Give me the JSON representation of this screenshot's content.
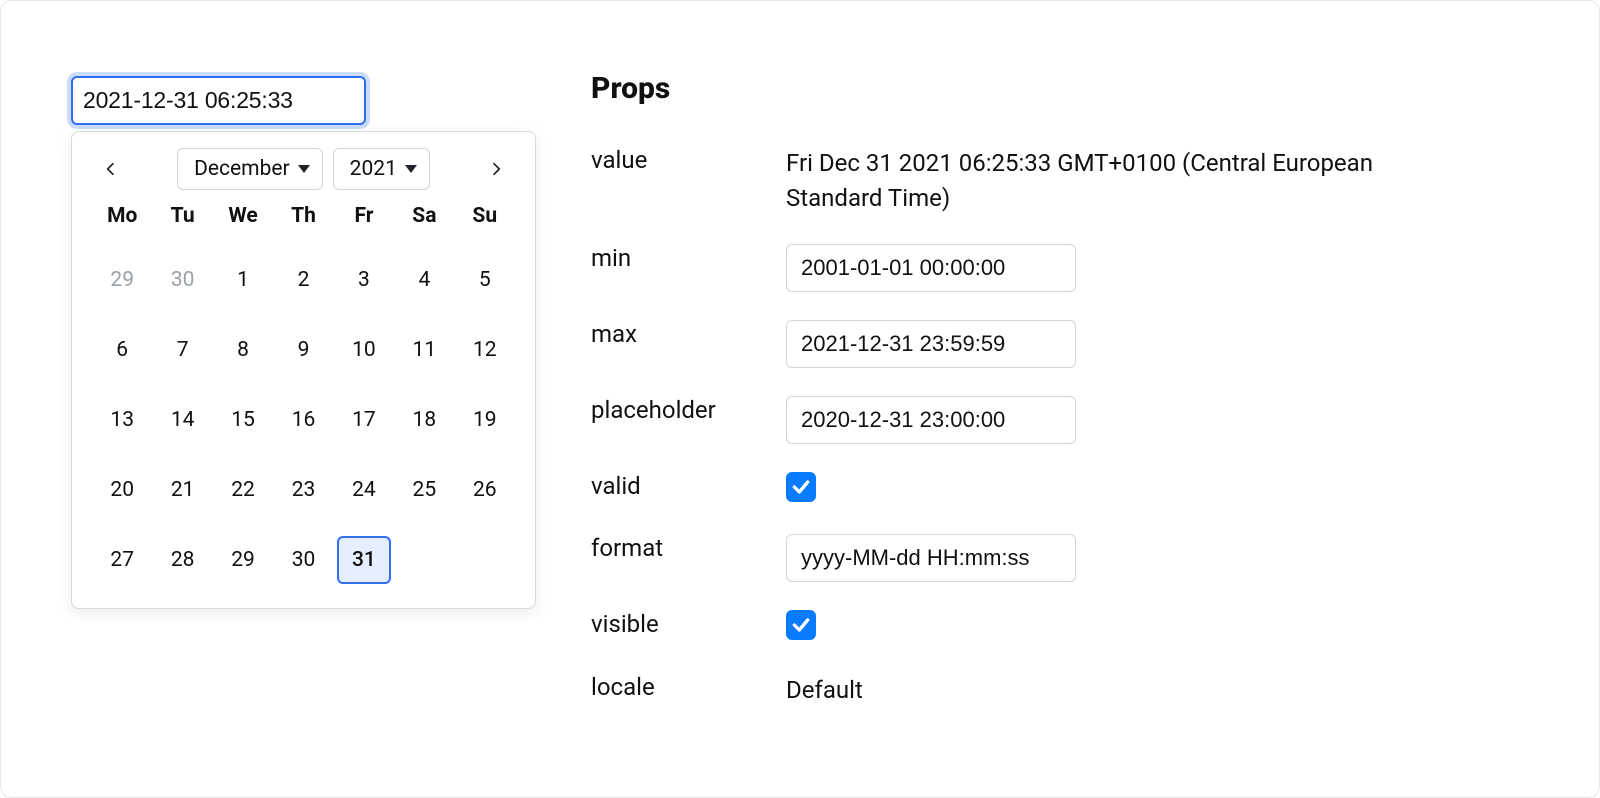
{
  "input": {
    "value": "2021-12-31 06:25:33"
  },
  "calendar": {
    "month": "December",
    "year": "2021",
    "dow": [
      "Mo",
      "Tu",
      "We",
      "Th",
      "Fr",
      "Sa",
      "Su"
    ],
    "days": [
      {
        "n": "29",
        "other": true
      },
      {
        "n": "30",
        "other": true
      },
      {
        "n": "1"
      },
      {
        "n": "2"
      },
      {
        "n": "3"
      },
      {
        "n": "4"
      },
      {
        "n": "5"
      },
      {
        "n": "6"
      },
      {
        "n": "7"
      },
      {
        "n": "8"
      },
      {
        "n": "9"
      },
      {
        "n": "10"
      },
      {
        "n": "11"
      },
      {
        "n": "12"
      },
      {
        "n": "13"
      },
      {
        "n": "14"
      },
      {
        "n": "15"
      },
      {
        "n": "16"
      },
      {
        "n": "17"
      },
      {
        "n": "18"
      },
      {
        "n": "19"
      },
      {
        "n": "20"
      },
      {
        "n": "21"
      },
      {
        "n": "22"
      },
      {
        "n": "23"
      },
      {
        "n": "24"
      },
      {
        "n": "25"
      },
      {
        "n": "26"
      },
      {
        "n": "27"
      },
      {
        "n": "28"
      },
      {
        "n": "29"
      },
      {
        "n": "30"
      },
      {
        "n": "31",
        "selected": true
      }
    ]
  },
  "props": {
    "title": "Props",
    "labels": {
      "value": "value",
      "min": "min",
      "max": "max",
      "placeholder": "placeholder",
      "valid": "valid",
      "format": "format",
      "visible": "visible",
      "locale": "locale"
    },
    "value": "Fri Dec 31 2021 06:25:33 GMT+0100 (Central European Standard Time)",
    "min": "2001-01-01 00:00:00",
    "max": "2021-12-31 23:59:59",
    "placeholder": "2020-12-31 23:00:00",
    "valid": true,
    "format": "yyyy-MM-dd HH:mm:ss",
    "visible": true,
    "locale": "Default"
  }
}
